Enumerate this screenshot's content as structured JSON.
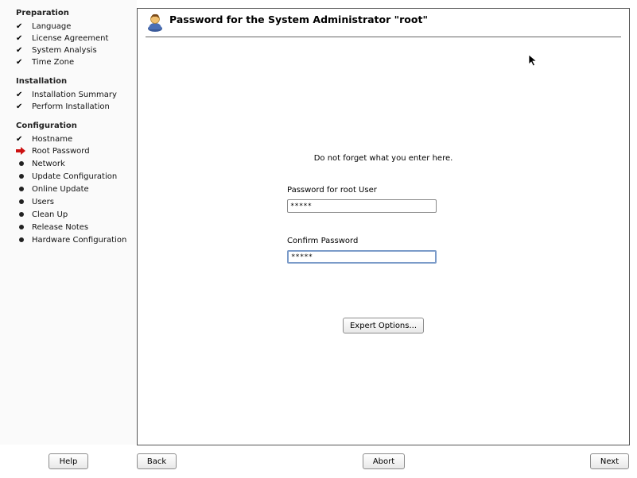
{
  "sidebar": {
    "sections": [
      {
        "heading": "Preparation",
        "steps": [
          {
            "label": "Language",
            "state": "done"
          },
          {
            "label": "License Agreement",
            "state": "done"
          },
          {
            "label": "System Analysis",
            "state": "done"
          },
          {
            "label": "Time Zone",
            "state": "done"
          }
        ]
      },
      {
        "heading": "Installation",
        "steps": [
          {
            "label": "Installation Summary",
            "state": "done"
          },
          {
            "label": "Perform Installation",
            "state": "done"
          }
        ]
      },
      {
        "heading": "Configuration",
        "steps": [
          {
            "label": "Hostname",
            "state": "done"
          },
          {
            "label": "Root Password",
            "state": "current"
          },
          {
            "label": "Network",
            "state": "pending"
          },
          {
            "label": "Update Configuration",
            "state": "pending"
          },
          {
            "label": "Online Update",
            "state": "pending"
          },
          {
            "label": "Users",
            "state": "pending"
          },
          {
            "label": "Clean Up",
            "state": "pending"
          },
          {
            "label": "Release Notes",
            "state": "pending"
          },
          {
            "label": "Hardware Configuration",
            "state": "pending"
          }
        ]
      }
    ]
  },
  "dialog": {
    "title": "Password for the System Administrator \"root\"",
    "hint": "Do not forget what you enter here.",
    "password_label": "Password for root User",
    "password_value": "*****",
    "confirm_label": "Confirm Password",
    "confirm_value": "*****",
    "expert_button": "Expert Options..."
  },
  "footer": {
    "help": "Help",
    "back": "Back",
    "abort": "Abort",
    "next": "Next"
  },
  "colors": {
    "current_arrow": "#cc1111",
    "focus_border": "#7b9bc9"
  }
}
